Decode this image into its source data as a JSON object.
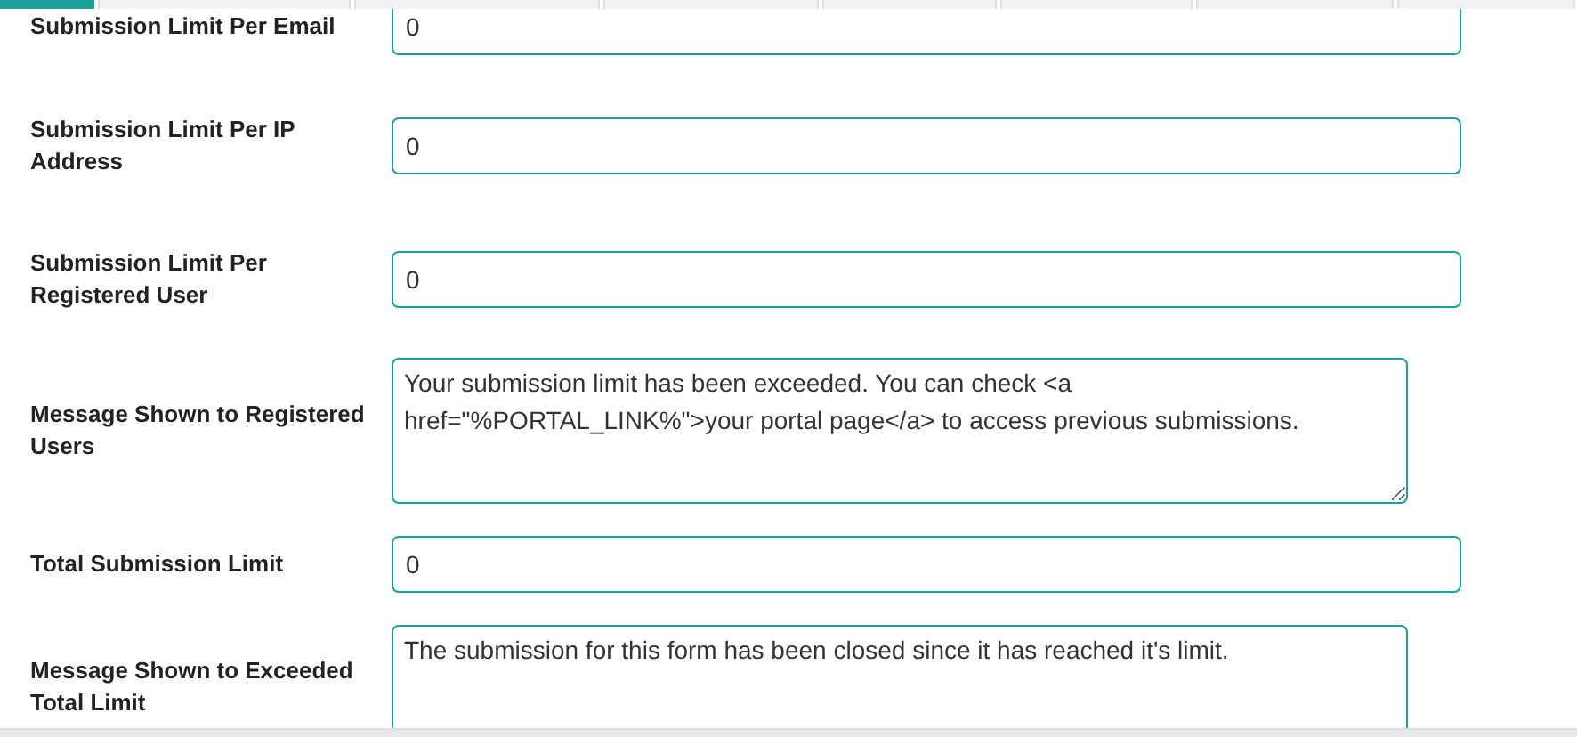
{
  "tabs": [
    {
      "selected": true
    },
    {
      "selected": false
    },
    {
      "selected": false
    },
    {
      "selected": false
    },
    {
      "selected": false
    },
    {
      "selected": false
    },
    {
      "selected": false
    },
    {
      "selected": false
    }
  ],
  "fields": [
    {
      "kind": "input",
      "label": "Submission Limit Per Email",
      "value": "0"
    },
    {
      "kind": "input",
      "label": "Submission Limit Per IP Address",
      "value": "0"
    },
    {
      "kind": "input",
      "label": "Submission Limit Per Registered User",
      "value": "0"
    },
    {
      "kind": "textarea",
      "label": "Message Shown to Registered Users",
      "value": "Your submission limit has been exceeded. You can check <a href=\"%PORTAL_LINK%\">your portal page</a> to access previous submissions."
    },
    {
      "kind": "input",
      "label": "Total Submission Limit",
      "value": "0"
    },
    {
      "kind": "textarea",
      "label": "Message Shown to Exceeded Total Limit",
      "value": "The submission for this form has been closed since it has reached it's limit."
    }
  ]
}
